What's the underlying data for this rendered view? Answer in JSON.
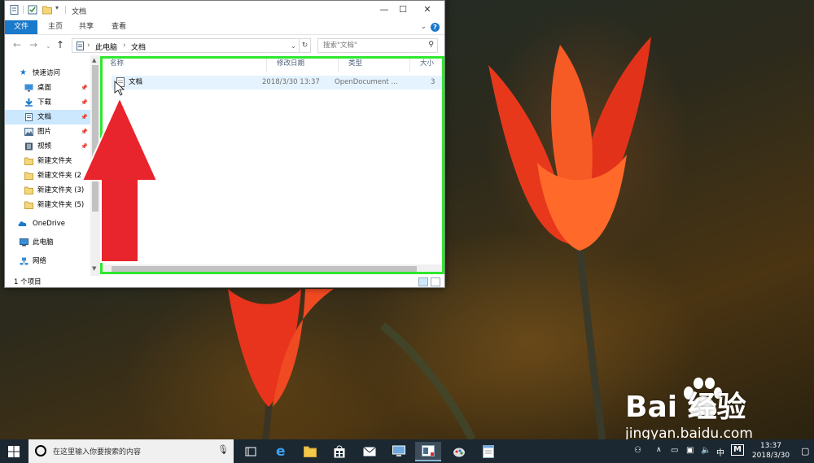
{
  "window": {
    "title": "文档",
    "controls": {
      "minimize": "—",
      "maximize": "☐",
      "close": "✕"
    }
  },
  "ribbon": {
    "tabs": [
      "文件",
      "主页",
      "共享",
      "查看"
    ],
    "help": "?"
  },
  "address": {
    "breadcrumb": [
      "此电脑",
      "文档"
    ],
    "search_placeholder": "搜索\"文档\""
  },
  "nav": {
    "quick_access": "快速访问",
    "items": [
      {
        "label": "桌面",
        "pinned": true
      },
      {
        "label": "下载",
        "pinned": true
      },
      {
        "label": "文档",
        "pinned": true,
        "selected": true
      },
      {
        "label": "图片",
        "pinned": true
      },
      {
        "label": "视频",
        "pinned": true
      },
      {
        "label": "新建文件夹"
      },
      {
        "label": "新建文件夹 (2"
      },
      {
        "label": "新建文件夹 (3)"
      },
      {
        "label": "新建文件夹 (5)"
      }
    ],
    "onedrive": "OneDrive",
    "this_pc": "此电脑",
    "network": "网络"
  },
  "columns": [
    "名称",
    "修改日期",
    "类型",
    "大小"
  ],
  "files": [
    {
      "name": "文档",
      "modified": "2018/3/30 13:37",
      "type": "OpenDocument ...",
      "size": "3"
    }
  ],
  "status": {
    "count": "1 个项目"
  },
  "taskbar": {
    "search_placeholder": "在这里输入你要搜索的内容",
    "time": "13:37",
    "date": "2018/3/30",
    "ime": "中",
    "ime_mode": "M"
  },
  "watermark": {
    "brand": "Bai 经验",
    "url": "jingyan.baidu.com"
  },
  "colors": {
    "accent": "#1979ca",
    "highlight_box": "#2ee82e",
    "arrow": "#e8242c",
    "selection": "#cce8ff"
  }
}
